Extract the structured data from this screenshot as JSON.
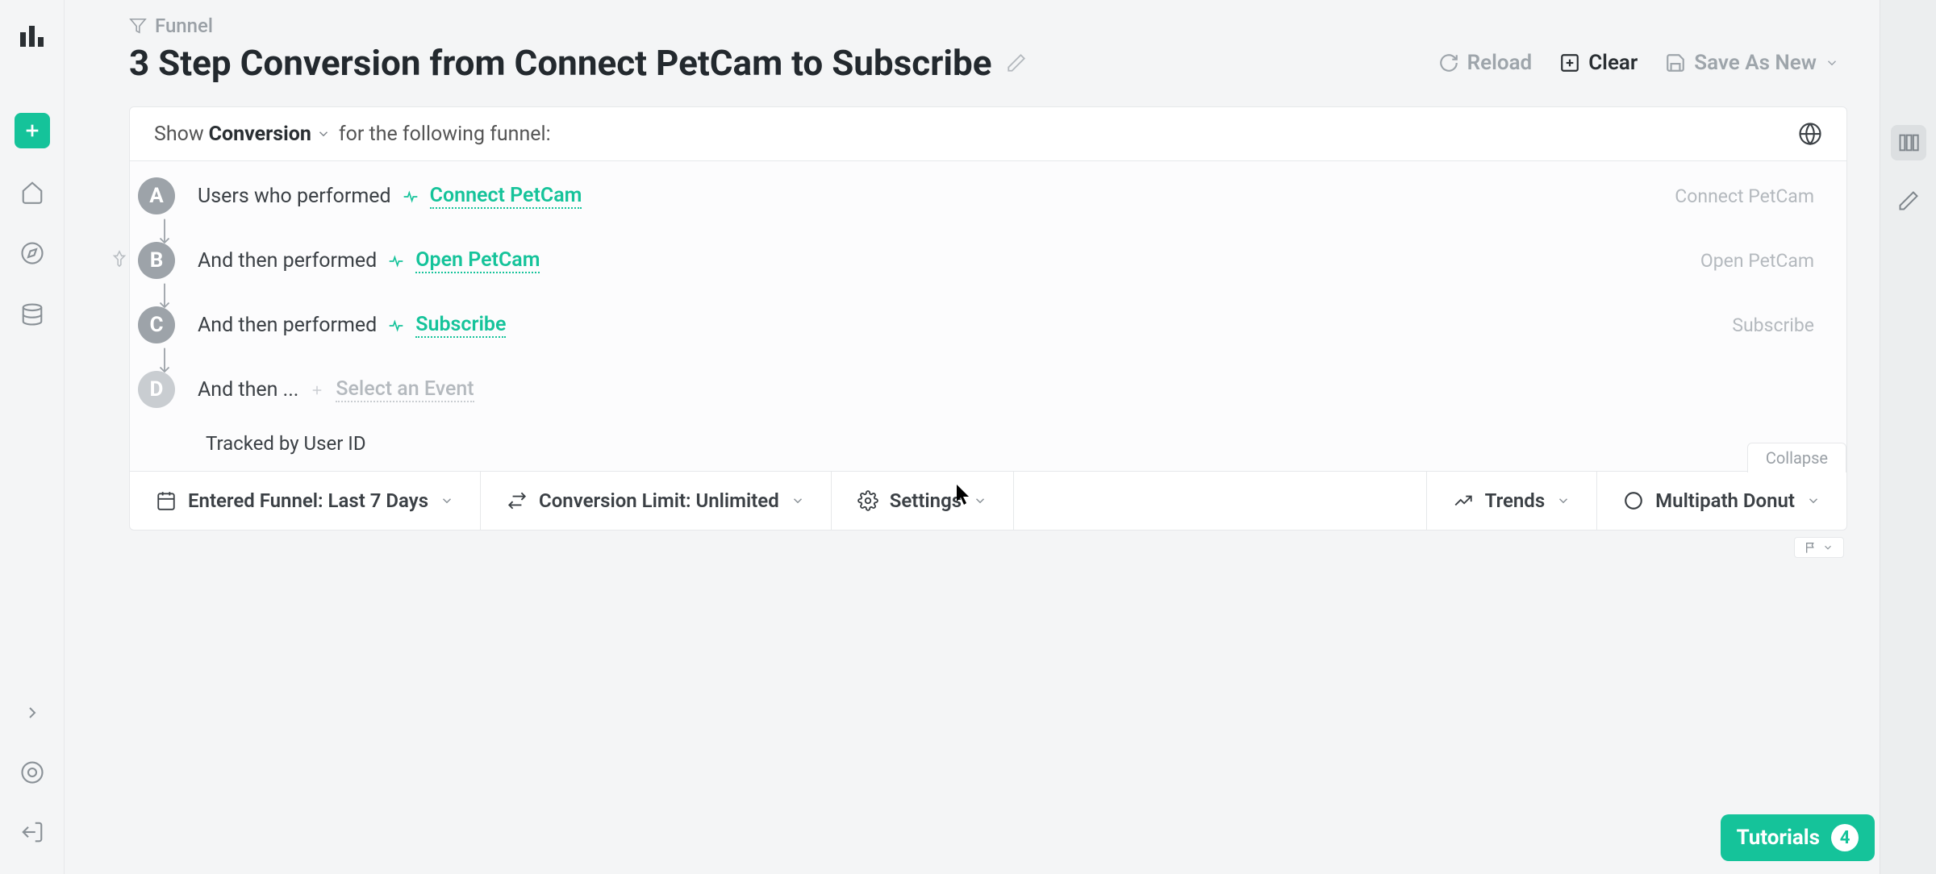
{
  "breadcrumb": {
    "label": "Funnel"
  },
  "title": "3 Step Conversion from Connect PetCam to Subscribe",
  "actions": {
    "reload": "Reload",
    "clear": "Clear",
    "save_as_new": "Save As New"
  },
  "config": {
    "show_prefix": "Show",
    "metric": "Conversion",
    "show_suffix": "for the following funnel:"
  },
  "steps": [
    {
      "letter": "A",
      "prefix": "Users who performed",
      "event": "Connect PetCam",
      "right_label": "Connect PetCam",
      "has_arrow": true
    },
    {
      "letter": "B",
      "prefix": "And then performed",
      "event": "Open PetCam",
      "right_label": "Open PetCam",
      "has_arrow": true,
      "pinned": true
    },
    {
      "letter": "C",
      "prefix": "And then performed",
      "event": "Subscribe",
      "right_label": "Subscribe",
      "has_arrow": true
    },
    {
      "letter": "D",
      "prefix": "And then ...",
      "placeholder": "Select an Event",
      "has_arrow": false,
      "muted": true
    }
  ],
  "tracked_by": "Tracked by User ID",
  "collapse": "Collapse",
  "settings_bar": {
    "date_range": "Entered Funnel: Last 7 Days",
    "conversion_limit": "Conversion Limit: Unlimited",
    "settings": "Settings",
    "trends": "Trends",
    "chart_type": "Multipath Donut"
  },
  "tutorials": {
    "label": "Tutorials",
    "count": "4"
  }
}
